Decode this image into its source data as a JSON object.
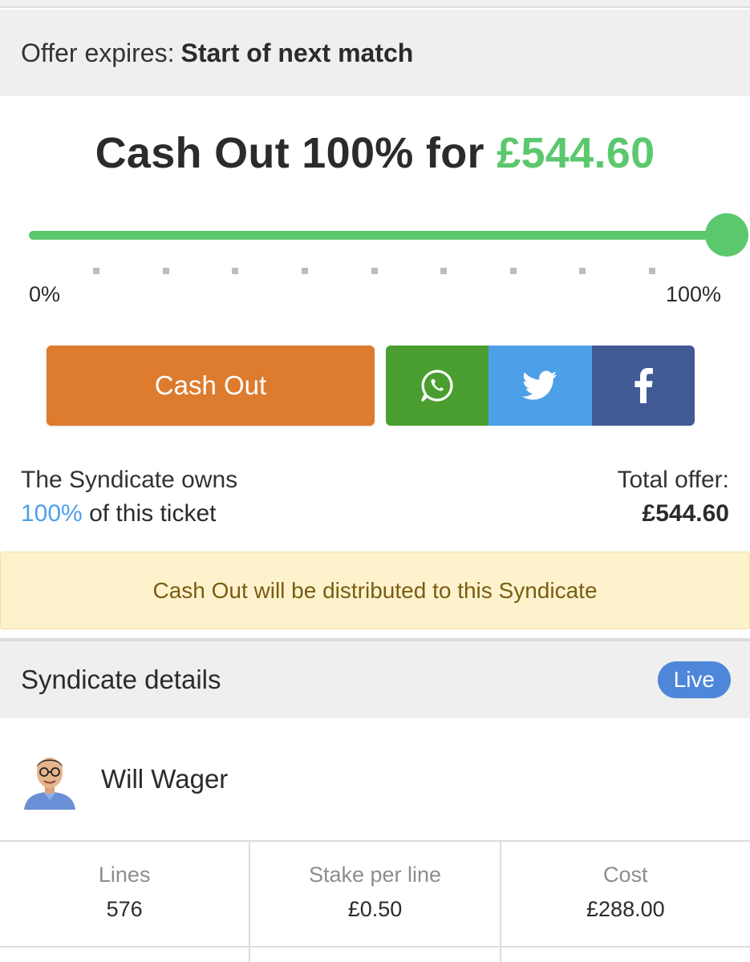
{
  "offer": {
    "label": "Offer expires:",
    "value": "Start of next match"
  },
  "headline": {
    "prefix": "Cash Out 100% for ",
    "amount": "£544.60"
  },
  "slider": {
    "value_fraction": 1.0,
    "min_label": "0%",
    "max_label": "100%",
    "tick_count": 9,
    "color": "#5cc86e"
  },
  "actions": {
    "cashout_label": "Cash Out",
    "share": [
      {
        "icon": "whatsapp-icon",
        "color": "#4a9e2f"
      },
      {
        "icon": "twitter-icon",
        "color": "#4da0e8"
      },
      {
        "icon": "facebook-icon",
        "color": "#415a96"
      }
    ]
  },
  "ownership": {
    "line1": "The Syndicate owns",
    "percent": "100%",
    "suffix": " of this ticket"
  },
  "total": {
    "label": "Total offer:",
    "amount": "£544.60"
  },
  "notice": "Cash Out will be distributed to this Syndicate",
  "syndicate": {
    "title": "Syndicate details",
    "status": "Live",
    "owner_name": "Will Wager",
    "stats": [
      {
        "label": "Lines",
        "value": "576"
      },
      {
        "label": "Stake per line",
        "value": "£0.50"
      },
      {
        "label": "Cost",
        "value": "£288.00"
      }
    ]
  }
}
